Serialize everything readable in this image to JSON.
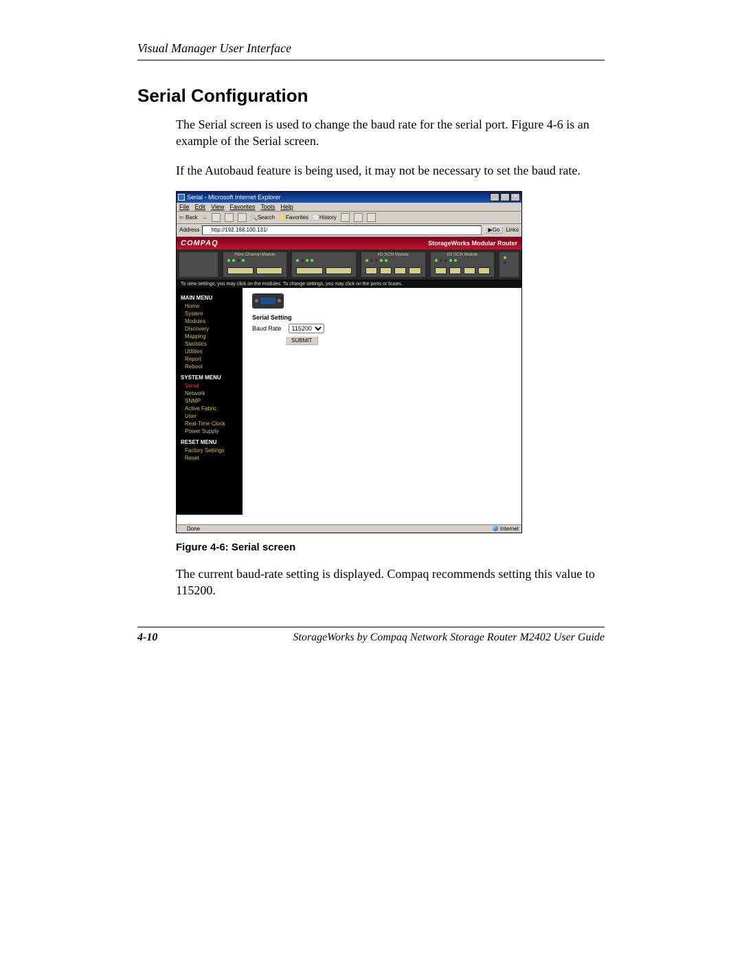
{
  "running_head": "Visual Manager User Interface",
  "section_title": "Serial Configuration",
  "para1": "The Serial screen is used to change the baud rate for the serial port. Figure 4-6 is an example of the Serial screen.",
  "para2": "If the Autobaud feature is being used, it may not be necessary to set the baud rate.",
  "caption": "Figure 4-6:  Serial screen",
  "para3": "The current baud-rate setting is displayed. Compaq recommends setting this value to 115200.",
  "footer_page": "4-10",
  "footer_book": "StorageWorks by Compaq Network Storage Router M2402 User Guide",
  "ie": {
    "title": "Serial - Microsoft Internet Explorer",
    "menu": {
      "file": "File",
      "edit": "Edit",
      "view": "View",
      "favorites": "Favorites",
      "tools": "Tools",
      "help": "Help"
    },
    "toolbar": {
      "back": "Back",
      "search": "Search",
      "favorites": "Favorites",
      "history": "History"
    },
    "address_label": "Address",
    "address_value": "http://192.168.100.131/",
    "go_label": "Go",
    "links_label": "Links",
    "status_left": "Done",
    "status_right": "Internet",
    "win_min": "_",
    "win_max": "□",
    "win_close": "×"
  },
  "app": {
    "brand": "COMPAQ",
    "product": "StorageWorks Modular Router",
    "modules": {
      "m0": "",
      "m1": "Fibre Channel Module",
      "m2": "",
      "m3": "I/O SCSI Module",
      "m4": "I/O SCSI Module"
    },
    "hint": "To view settings, you may click on the modules. To change settings, you may click on the ports or buses.",
    "nav": {
      "main_head": "MAIN MENU",
      "home": "Home",
      "system": "System",
      "modules": "Modules",
      "discovery": "Discovery",
      "mapping": "Mapping",
      "statistics": "Statistics",
      "utilities": "Utilities",
      "report": "Report",
      "reboot": "Reboot",
      "sys_head": "SYSTEM MENU",
      "serial": "Serial",
      "network": "Network",
      "snmp": "SNMP",
      "active_fabric": "Active Fabric",
      "user": "User",
      "rtc": "Real-Time Clock",
      "power": "Power Supply",
      "reset_head": "RESET MENU",
      "factory": "Factory Settings Reset"
    },
    "panel": {
      "heading": "Serial Setting",
      "baud_label": "Baud Rate",
      "baud_value": "115200",
      "submit": "SUBMIT"
    }
  }
}
